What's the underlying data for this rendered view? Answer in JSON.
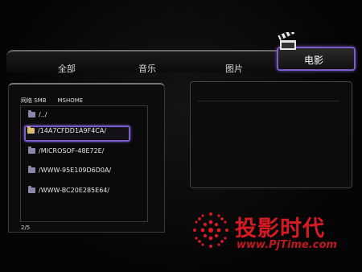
{
  "tabs": [
    {
      "label": "全部"
    },
    {
      "label": "音乐"
    },
    {
      "label": "图片"
    },
    {
      "label": "电影",
      "active": true
    }
  ],
  "browser": {
    "breadcrumb": {
      "network": "网络 SMB",
      "host": "MSHOME"
    },
    "items": [
      {
        "label": "/../",
        "icon": "folder-icon"
      },
      {
        "label": "/14A7CFDD1A9F4CA/",
        "icon": "folder-icon",
        "selected": true
      },
      {
        "label": "/MICROSOF-48E72E/",
        "icon": "folder-icon"
      },
      {
        "label": "/WWW-95E109D6D0A/",
        "icon": "folder-icon"
      },
      {
        "label": "/WWW-BC20E285E64/",
        "icon": "folder-icon"
      }
    ],
    "page": "2/5"
  },
  "watermark": {
    "title": "投影时代",
    "url": "www.PjTime.com"
  },
  "colors": {
    "accent": "#7a5ccc",
    "watermark": "#d81a24",
    "background": "#080808"
  }
}
